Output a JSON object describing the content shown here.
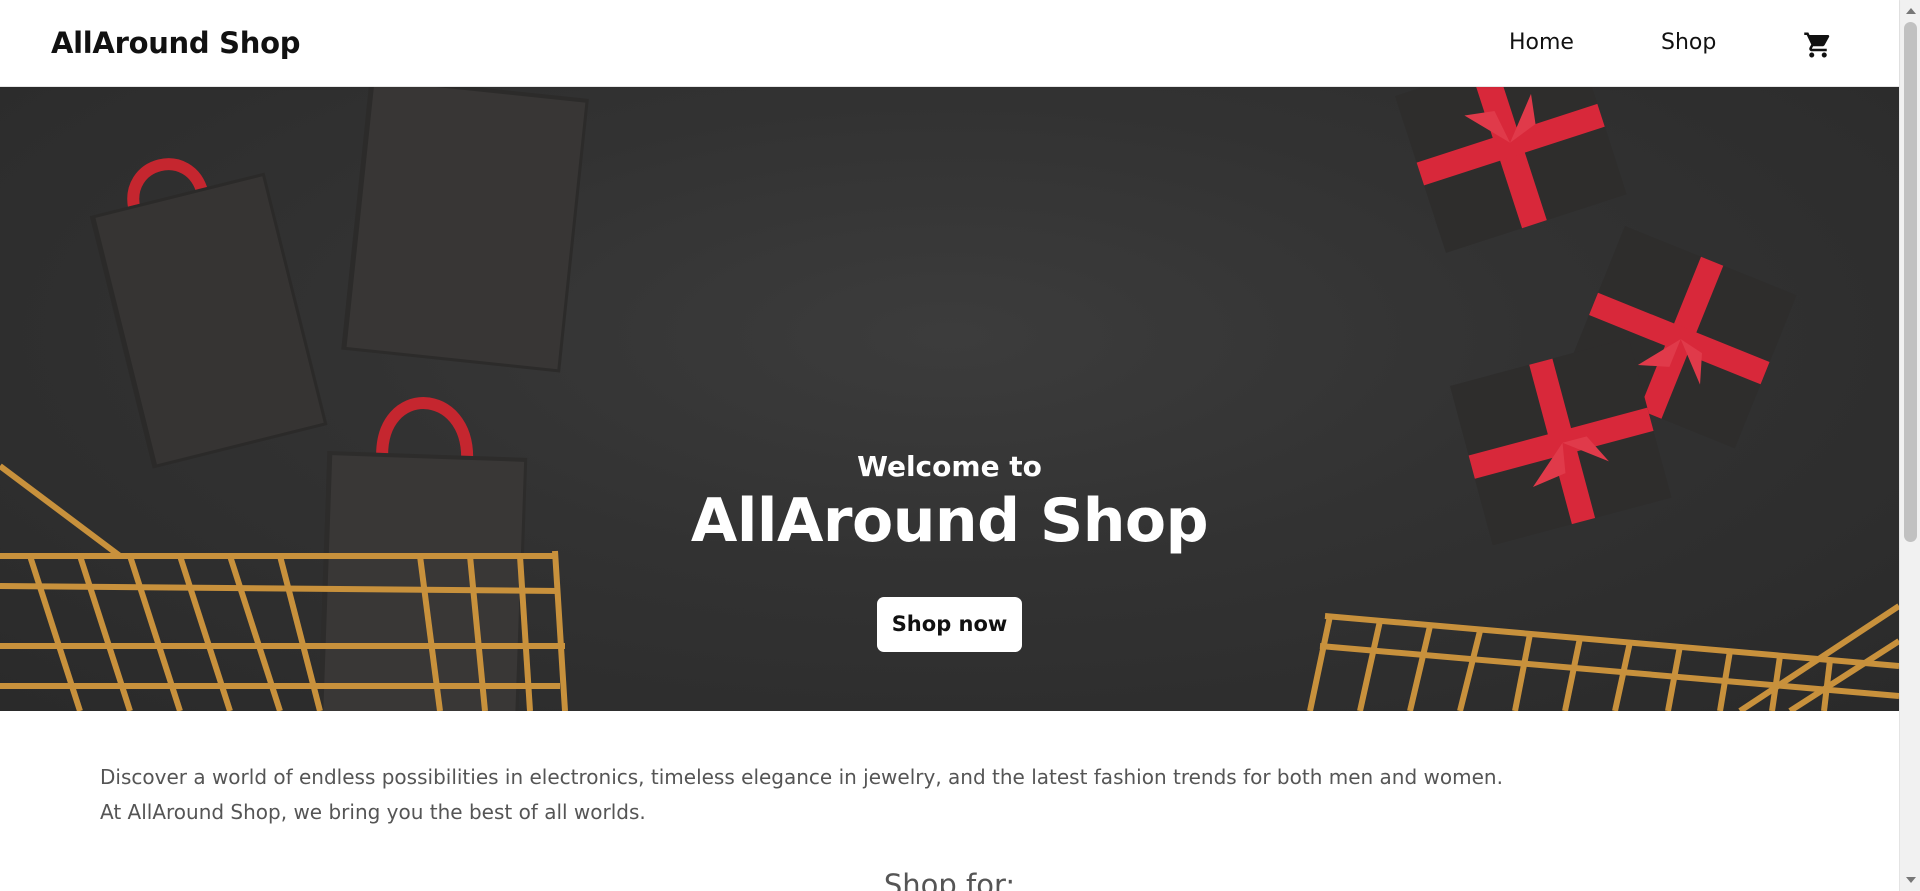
{
  "header": {
    "brand": "AllAround Shop",
    "nav": [
      {
        "label": "Home"
      },
      {
        "label": "Shop"
      }
    ],
    "cart_icon": "shopping-cart-icon"
  },
  "hero": {
    "welcome": "Welcome to",
    "title": "AllAround Shop",
    "cta_label": "Shop now"
  },
  "intro": {
    "line1": "Discover a world of endless possibilities in electronics, timeless elegance in jewelry, and the latest fashion trends for both men and women.",
    "line2": "At AllAround Shop, we bring you the best of all worlds."
  },
  "sections": {
    "shop_for_heading": "Shop for:"
  },
  "colors": {
    "hero_background": "#323232",
    "ribbon_red": "#d8283a",
    "cart_gold": "#c8913c",
    "text_dark": "#111111",
    "text_muted": "#555555"
  }
}
